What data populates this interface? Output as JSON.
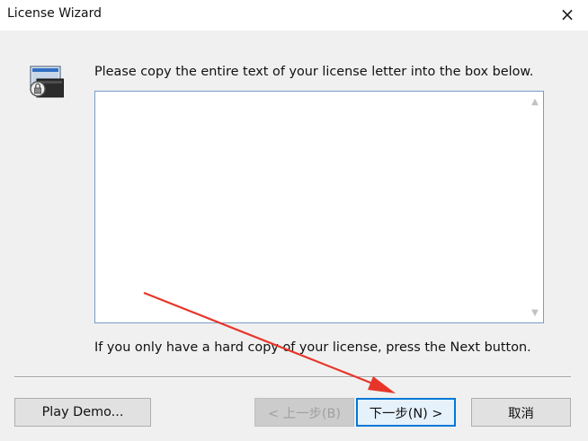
{
  "window": {
    "title": "License Wizard",
    "close_icon": "×"
  },
  "main": {
    "icon": "license-wizard-icon",
    "prompt": "Please copy the entire text of your license letter into the box below.",
    "license_text": "",
    "hint": "If you only have a hard copy of your license, press the Next button."
  },
  "buttons": {
    "play_demo": "Play Demo...",
    "back": "< 上一步(B)",
    "next": "下一步(N) >",
    "cancel": "取消"
  },
  "annotation": {
    "arrow_color": "#e8352a",
    "points_to": "next-button"
  },
  "colors": {
    "window_bg": "#f0f0f0",
    "accent": "#0078d7",
    "textbox_border": "#7a9cc6"
  }
}
